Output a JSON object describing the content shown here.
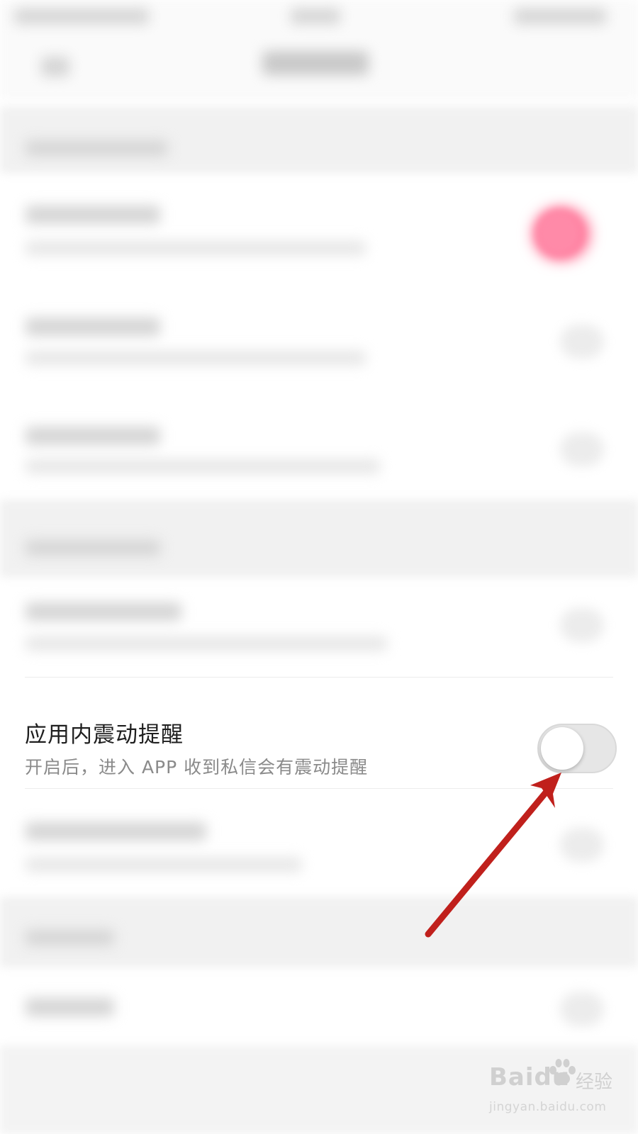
{
  "setting": {
    "title": "应用内震动提醒",
    "description": "开启后，进入 APP 收到私信会有震动提醒",
    "toggle_on": false
  },
  "colors": {
    "toggle_track_off": "#e6e6e6",
    "annotation_arrow": "#c0201c",
    "blurred_toggle_on": "#ff6f93"
  },
  "watermark": {
    "brand": "Baidu",
    "product": "经验",
    "url": "jingyan.baidu.com"
  }
}
